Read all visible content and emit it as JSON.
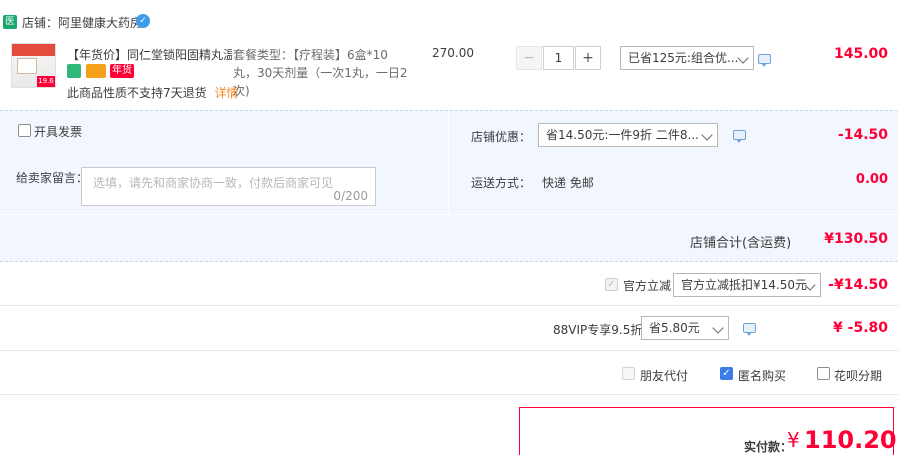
{
  "shop": {
    "badge": "医",
    "label": "店铺：阿里健康大药房",
    "verified_icon": "verified-badge-icon"
  },
  "item": {
    "title": "【年货价】同仁堂锁阳固精丸温...",
    "thumb_price": "19.6",
    "tag_year": "年货",
    "no_return": "此商品性质不支持7天退货",
    "details_link": "详情",
    "package_lines": [
      "套餐类型：【疗程装】6盒*10",
      "丸，30天剂量（一次1丸，一日2",
      "次)"
    ],
    "unit_price": "270.00",
    "quantity": "1",
    "minus": "−",
    "plus": "+",
    "discount_select": "已省125元:组合优...",
    "subtotal": "145.00"
  },
  "invoice": {
    "label": "开具发票"
  },
  "shop_discount": {
    "label": "店铺优惠：",
    "select": "省14.50元:一件9折 二件8...",
    "amount": "-14.50"
  },
  "message": {
    "label": "给卖家留言：",
    "placeholder": "选填，请先和商家协商一致，付款后商家可见",
    "counter": "0/200"
  },
  "shipping": {
    "label": "运送方式：",
    "value": "快递 免邮",
    "amount": "0.00"
  },
  "shop_total": {
    "label": "店铺合计(含运费)",
    "value": "¥130.50"
  },
  "official": {
    "label": "官方立减",
    "select": "官方立减抵扣¥14.50元",
    "amount": "-¥14.50"
  },
  "vip": {
    "label": "88VIP专享9.5折",
    "select": "省5.80元",
    "amount": "¥ -5.80"
  },
  "options": {
    "friend_pay": "朋友代付",
    "anonymous": "匿名购买",
    "huabei": "花呗分期"
  },
  "payment": {
    "label": "实付款：",
    "currency": "¥",
    "value": "110.20"
  },
  "colors": {
    "accent_red": "#ff0036",
    "blue_bg": "#f2f7ff",
    "checkbox_blue": "#3a7de8",
    "verified_blue": "#3d9be9",
    "badge_green": "#18a870"
  }
}
